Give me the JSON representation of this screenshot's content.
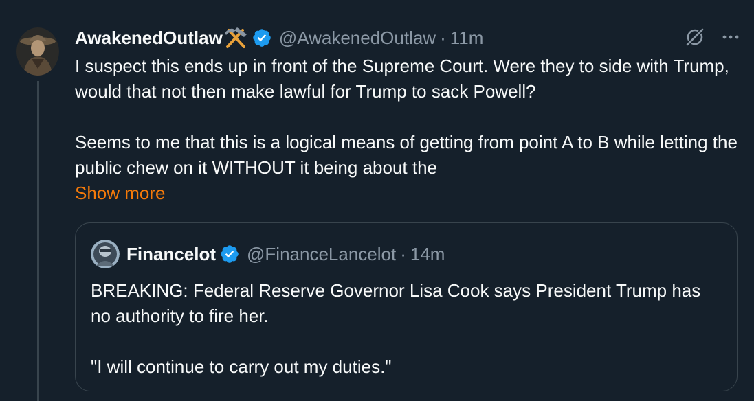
{
  "tweet": {
    "display_name": "AwakenedOutlaw",
    "name_emoji": "hammer-and-pick-icon",
    "handle": "@AwakenedOutlaw",
    "separator": "·",
    "time": "11m",
    "paragraphs": [
      "I suspect this ends up in front of the Supreme Court.  Were they to side with Trump, would that not then make lawful for Trump to sack Powell?",
      "Seems to me that this is a logical means of getting from point A to B while letting the public chew on it WITHOUT it being about the"
    ],
    "show_more": "Show more"
  },
  "quote": {
    "display_name": "Financelot",
    "handle": "@FinanceLancelot",
    "separator": "·",
    "time": "14m",
    "paragraphs": [
      "BREAKING: Federal Reserve Governor Lisa Cook says President Trump has no authority to fire her.",
      "\"I will continue to carry out my duties.\""
    ]
  },
  "icons": {
    "verified": "verified-badge-icon",
    "grok": "grok-icon",
    "more": "more-options-icon"
  },
  "colors": {
    "background": "#15202b",
    "text": "#f7f9f9",
    "secondary_text": "#8b98a5",
    "show_more": "#f47a0a",
    "verified": "#1d9bf0",
    "border": "#38444d"
  }
}
